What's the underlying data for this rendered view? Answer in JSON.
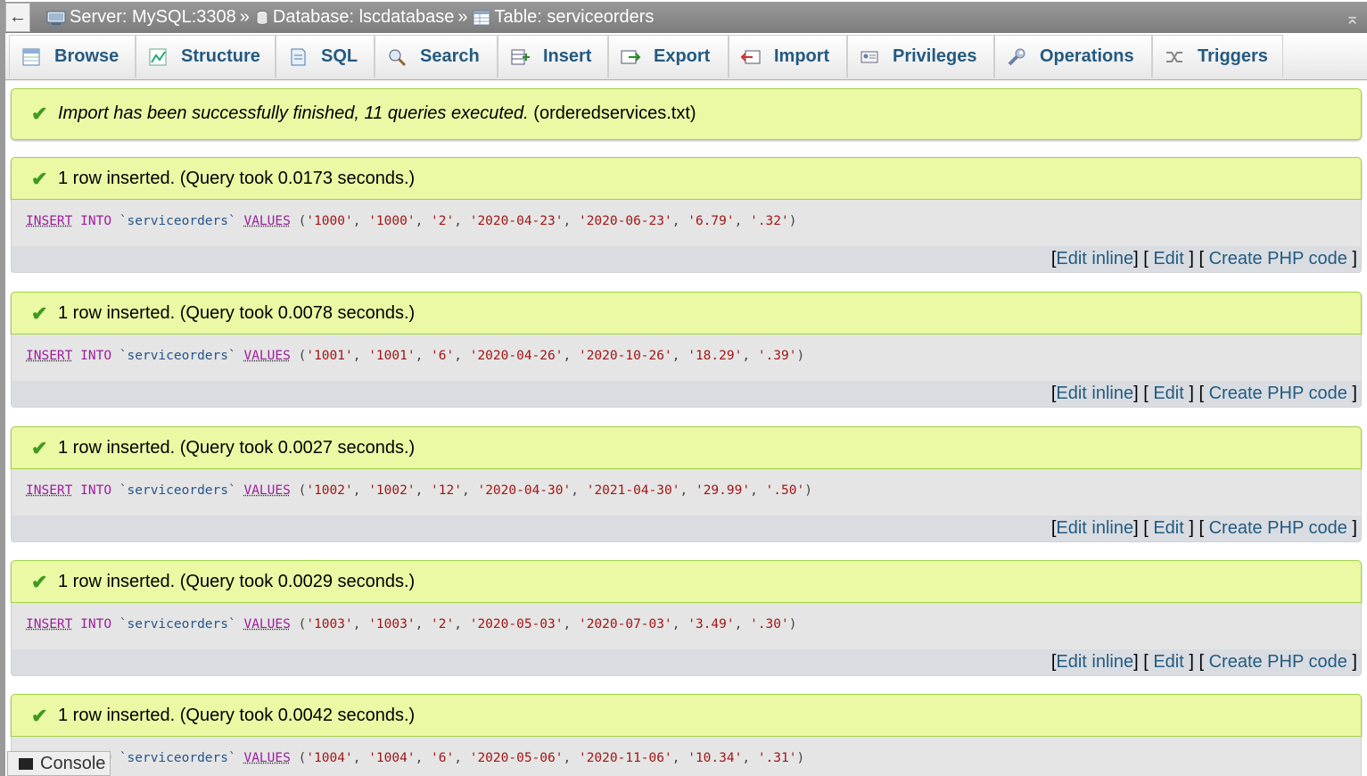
{
  "breadcrumb": {
    "back": "←",
    "server": "Server: MySQL:3308",
    "database": "Database: lscdatabase",
    "table": "Table: serviceorders",
    "separator": "»",
    "collapse": "⌅"
  },
  "tabs": [
    {
      "label": "Browse",
      "icon": "browse-icon"
    },
    {
      "label": "Structure",
      "icon": "structure-icon"
    },
    {
      "label": "SQL",
      "icon": "sql-icon"
    },
    {
      "label": "Search",
      "icon": "search-icon"
    },
    {
      "label": "Insert",
      "icon": "insert-icon"
    },
    {
      "label": "Export",
      "icon": "export-icon"
    },
    {
      "label": "Import",
      "icon": "import-icon"
    },
    {
      "label": "Privileges",
      "icon": "privileges-icon"
    },
    {
      "label": "Operations",
      "icon": "operations-icon"
    },
    {
      "label": "Triggers",
      "icon": "triggers-icon"
    }
  ],
  "import_message": {
    "text": "Import has been successfully finished, 11 queries executed.",
    "file": "(orderedservices.txt)"
  },
  "results": [
    {
      "status": "1 row inserted. (Query took 0.0173 seconds.)",
      "values": [
        "1000",
        "1000",
        "2",
        "2020-04-23",
        "2020-06-23",
        "6.79",
        ".32"
      ]
    },
    {
      "status": "1 row inserted. (Query took 0.0078 seconds.)",
      "values": [
        "1001",
        "1001",
        "6",
        "2020-04-26",
        "2020-10-26",
        "18.29",
        ".39"
      ]
    },
    {
      "status": "1 row inserted. (Query took 0.0027 seconds.)",
      "values": [
        "1002",
        "1002",
        "12",
        "2020-04-30",
        "2021-04-30",
        "29.99",
        ".50"
      ]
    },
    {
      "status": "1 row inserted. (Query took 0.0029 seconds.)",
      "values": [
        "1003",
        "1003",
        "2",
        "2020-05-03",
        "2020-07-03",
        "3.49",
        ".30"
      ]
    },
    {
      "status": "1 row inserted. (Query took 0.0042 seconds.)",
      "values": [
        "1004",
        "1004",
        "6",
        "2020-05-06",
        "2020-11-06",
        "10.34",
        ".31"
      ]
    }
  ],
  "sql": {
    "insert": "INSERT",
    "into": "INTO",
    "table": "`serviceorders`",
    "values_kw": "VALUES"
  },
  "actions": {
    "edit_inline": "Edit inline",
    "edit": "Edit",
    "create_php": "Create PHP code"
  },
  "console": {
    "label": "Console"
  },
  "colors": {
    "success_bg": "#ebf8a4",
    "success_border": "#a2d246",
    "link": "#235a81",
    "keyword": "#9c1e9c",
    "string": "#a31515"
  }
}
